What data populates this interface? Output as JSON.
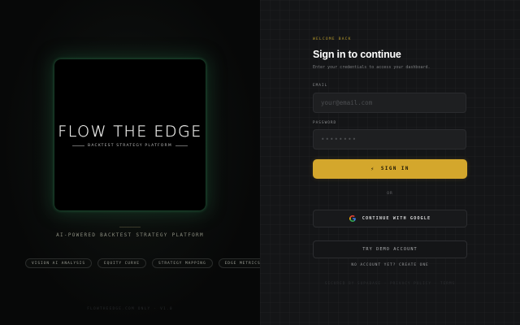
{
  "brand": {
    "title": "FLOW THE EDGE",
    "subtitle": "BACKTEST STRATEGY PLATFORM",
    "tagline": "AI-POWERED BACKTEST STRATEGY PLATFORM",
    "chips": [
      "VISION AI ANALYSIS",
      "EQUITY CURVE",
      "STRATEGY MAPPING",
      "EDGE METRICS"
    ],
    "footer": "FLOWTHEEDGE.COM ONLY · V1.0"
  },
  "login": {
    "eyebrow": "WELCOME BACK",
    "title": "Sign in to continue",
    "subtitle": "Enter your credentials to access your dashboard.",
    "email_label": "EMAIL",
    "email_placeholder": "your@email.com",
    "password_label": "PASSWORD",
    "password_placeholder": "••••••••",
    "signin_label": "SIGN IN",
    "or_label": "OR",
    "google_label": "CONTINUE WITH GOOGLE",
    "demo_label": "TRY DEMO ACCOUNT",
    "no_account": "NO ACCOUNT YET? CREATE ONE",
    "footer": "SECURED BY SUPABASE · PRIVACY POLICY · TERMS"
  },
  "colors": {
    "accent": "#d4a72c",
    "left_bg": "#070808",
    "right_bg": "#141517",
    "glow": "#226e46"
  },
  "icons": {
    "signin": "bolt-icon",
    "google": "google-icon"
  }
}
